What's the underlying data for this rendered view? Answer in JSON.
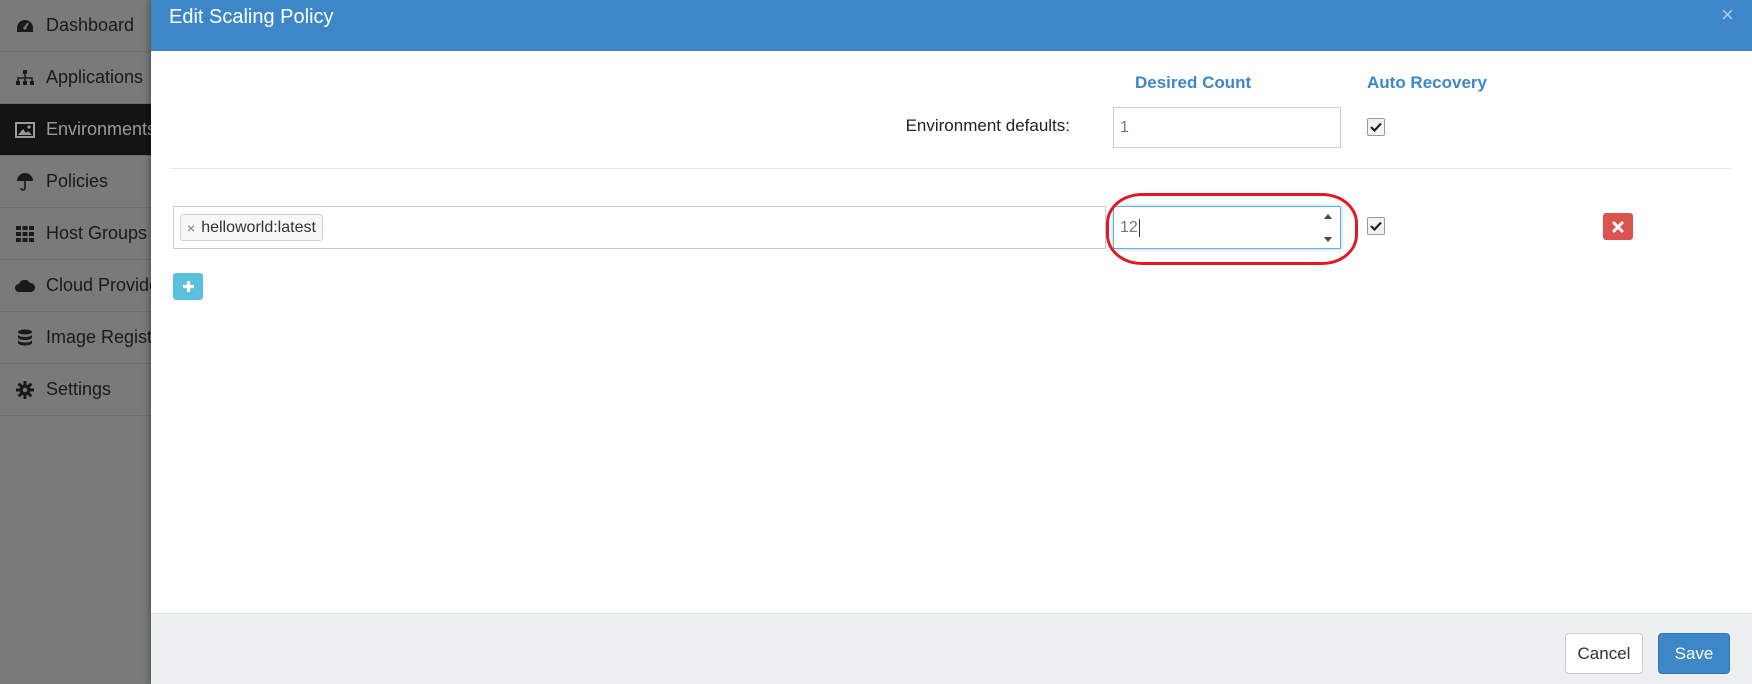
{
  "sidebar": {
    "items": [
      {
        "label": "Dashboard",
        "icon": "dashboard-icon"
      },
      {
        "label": "Applications",
        "icon": "sitemap-icon"
      },
      {
        "label": "Environments",
        "icon": "image-icon",
        "active": true
      },
      {
        "label": "Policies",
        "icon": "umbrella-icon"
      },
      {
        "label": "Host Groups",
        "icon": "grid-icon"
      },
      {
        "label": "Cloud Provide",
        "icon": "cloud-icon"
      },
      {
        "label": "Image Registr",
        "icon": "database-icon"
      },
      {
        "label": "Settings",
        "icon": "gear-icon"
      }
    ]
  },
  "modal": {
    "title": "Edit Scaling Policy",
    "close_symbol": "×",
    "columns": {
      "desired_count": "Desired Count",
      "auto_recovery": "Auto Recovery"
    },
    "environment_defaults": {
      "label": "Environment defaults:",
      "desired_count": "1",
      "auto_recovery": true
    },
    "rows": [
      {
        "tags": [
          {
            "label": "helloworld:latest",
            "remove_symbol": "×"
          }
        ],
        "desired_count": "12",
        "auto_recovery": true
      }
    ],
    "footer": {
      "cancel_label": "Cancel",
      "save_label": "Save"
    }
  },
  "colors": {
    "primary": "#3d87c8",
    "danger": "#d9534f",
    "info": "#5bc0de",
    "highlight": "#e01a22"
  }
}
